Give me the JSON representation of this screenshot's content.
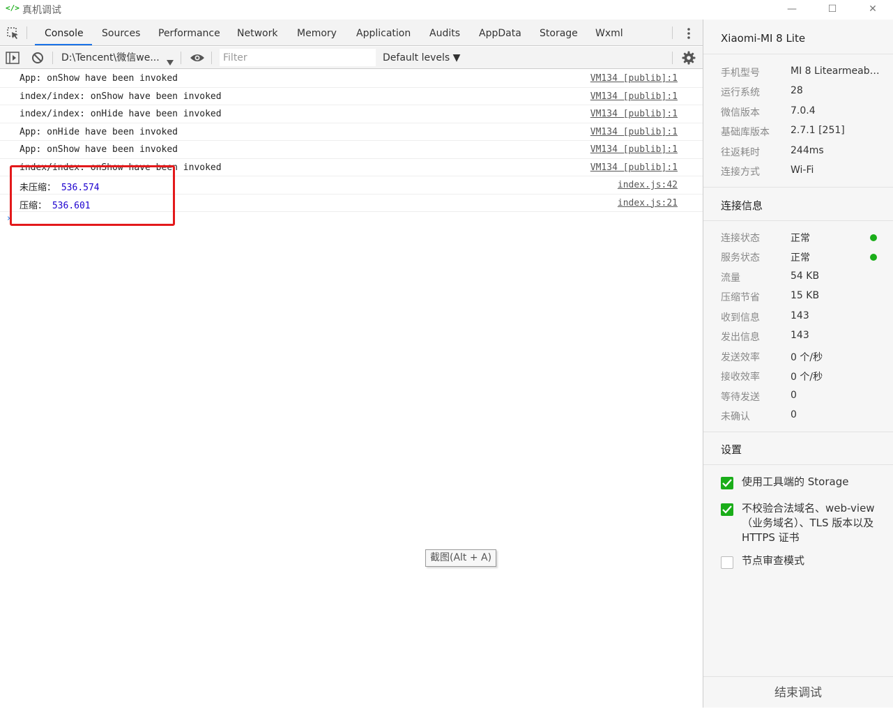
{
  "window": {
    "logo": "</>",
    "title": "真机调试",
    "minimize": "—",
    "maximize": "☐",
    "close": "✕"
  },
  "tabs": [
    {
      "label": "Console",
      "active": true
    },
    {
      "label": "Sources"
    },
    {
      "label": "Performance"
    },
    {
      "label": "Network"
    },
    {
      "label": "Memory"
    },
    {
      "label": "Application"
    },
    {
      "label": "Audits"
    },
    {
      "label": "AppData"
    },
    {
      "label": "Storage"
    },
    {
      "label": "Wxml"
    }
  ],
  "toolbar": {
    "context": "D:\\Tencent\\微信we...",
    "filter_placeholder": "Filter",
    "levels": "Default levels ▼"
  },
  "logs": [
    {
      "text": "App: onShow have been invoked",
      "source": "VM134 [publib]:1"
    },
    {
      "text": "index/index: onShow have been invoked",
      "source": "VM134 [publib]:1"
    },
    {
      "text": "index/index: onHide have been invoked",
      "source": "VM134 [publib]:1"
    },
    {
      "text": "App: onHide have been invoked",
      "source": "VM134 [publib]:1"
    },
    {
      "text": "App: onShow have been invoked",
      "source": "VM134 [publib]:1"
    },
    {
      "text": "index/index: onShow have been invoked",
      "source": "VM134 [publib]:1"
    },
    {
      "label": "未压缩：",
      "value": "536.574",
      "source": "index.js:42"
    },
    {
      "label": "压缩：",
      "value": "536.601",
      "source": "index.js:21"
    }
  ],
  "prompt": "›",
  "tooltip": "截图(Alt + A)",
  "device": {
    "name": "Xiaomi-MI 8 Lite",
    "info": [
      {
        "key": "手机型号",
        "value": "MI 8 Litearmeabi..."
      },
      {
        "key": "运行系统",
        "value": "28"
      },
      {
        "key": "微信版本",
        "value": "7.0.4"
      },
      {
        "key": "基础库版本",
        "value": "2.7.1 [251]"
      },
      {
        "key": "往返耗时",
        "value": "244ms"
      },
      {
        "key": "连接方式",
        "value": "Wi-Fi"
      }
    ]
  },
  "connection": {
    "title": "连接信息",
    "items": [
      {
        "key": "连接状态",
        "value": "正常",
        "status": "ok"
      },
      {
        "key": "服务状态",
        "value": "正常",
        "status": "ok"
      },
      {
        "key": "流量",
        "value": "54 KB"
      },
      {
        "key": "压缩节省",
        "value": "15 KB"
      },
      {
        "key": "收到信息",
        "value": "143"
      },
      {
        "key": "发出信息",
        "value": "143"
      },
      {
        "key": "发送效率",
        "value": "0 个/秒"
      },
      {
        "key": "接收效率",
        "value": "0 个/秒"
      },
      {
        "key": "等待发送",
        "value": "0"
      },
      {
        "key": "未确认",
        "value": "0"
      }
    ]
  },
  "settings": {
    "title": "设置",
    "options": [
      {
        "label": "使用工具端的 Storage",
        "checked": true
      },
      {
        "label": "不校验合法域名、web-view（业务域名）、TLS 版本以及 HTTPS 证书",
        "checked": true
      },
      {
        "label": "节点审查模式",
        "checked": false
      }
    ]
  },
  "end_button": "结束调试",
  "colors": {
    "accent": "#1aad19",
    "tab_underline": "#1a73e8",
    "highlight": "#e3191b",
    "number": "#1c00cf"
  }
}
